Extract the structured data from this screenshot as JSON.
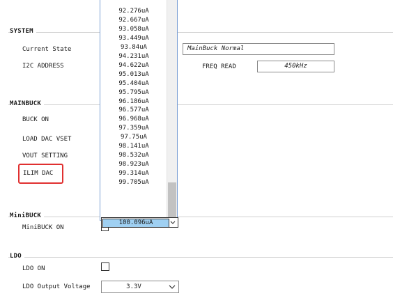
{
  "system": {
    "title": "SYSTEM",
    "current_state_label": "Current State",
    "current_state_value": "MainBuck Normal",
    "i2c_address_label": "I2C ADDRESS",
    "freq_read_label": "FREQ READ",
    "freq_read_value": "450kHz"
  },
  "mainbuck": {
    "title": "MAINBUCK",
    "buck_on_label": "BUCK ON",
    "load_dac_vset_label": "LOAD DAC VSET",
    "vout_setting_label": "VOUT SETTING",
    "ilim_dac_label": "ILIM DAC"
  },
  "minibuck": {
    "title": "MiniBUCK",
    "minibuck_on_label": "MiniBUCK ON"
  },
  "ldo": {
    "title": "LDO",
    "ldo_on_label": "LDO ON",
    "ldo_output_voltage_label": "LDO Output Voltage",
    "ldo_output_voltage_value": "3.3V"
  },
  "ilim_dropdown": {
    "options": [
      "92.276uA",
      "92.667uA",
      "93.058uA",
      "93.449uA",
      "93.84uA",
      "94.231uA",
      "94.622uA",
      "95.013uA",
      "95.404uA",
      "95.795uA",
      "96.186uA",
      "96.577uA",
      "96.968uA",
      "97.359uA",
      "97.75uA",
      "98.141uA",
      "98.532uA",
      "98.923uA",
      "99.314uA",
      "99.705uA"
    ],
    "selected_value": "100.096uA"
  },
  "colors": {
    "highlight": "#e03030",
    "selected_bg": "#9fd0f2",
    "dropdown_border": "#7a9fd4"
  }
}
